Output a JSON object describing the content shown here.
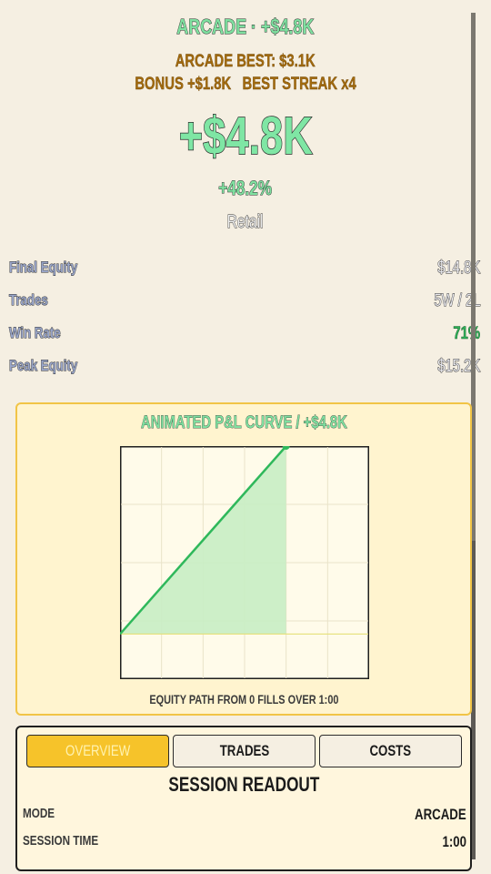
{
  "header": {
    "title": "ARCADE · +$4.8K",
    "best_line": "ARCADE BEST: $3.1K",
    "bonus_line": "BONUS +$1.8K   BEST STREAK x4",
    "pnl_big": "+$4.8K",
    "pnl_pct": "+48.2%",
    "tier": "Retail"
  },
  "stats": [
    {
      "label": "Final Equity",
      "value": "$14.8K"
    },
    {
      "label": "Trades",
      "value": "5W / 2L"
    },
    {
      "label": "Win Rate",
      "value": "71%"
    },
    {
      "label": "Peak Equity",
      "value": "$15.2K"
    }
  ],
  "chart_panel": {
    "title": "ANIMATED P&L CURVE / +$4.8K",
    "footer": "EQUITY PATH FROM 0 FILLS OVER 1:00"
  },
  "chart_data": {
    "type": "area",
    "title": "ANIMATED P&L CURVE / +$4.8K",
    "xlabel": "",
    "ylabel": "",
    "x": [
      0,
      1
    ],
    "y": [
      0,
      1
    ],
    "xlim": [
      0,
      1.5
    ],
    "ylim": [
      -0.24,
      1.0
    ],
    "grid": true,
    "colors": {
      "line": "#2fb85b",
      "fill": "#c8edc4",
      "baseline": "#e6e07a",
      "grid": "#e9e3c9"
    }
  },
  "tabs": [
    {
      "id": "overview",
      "label": "OVERVIEW",
      "active": true
    },
    {
      "id": "trades",
      "label": "TRADES",
      "active": false
    },
    {
      "id": "costs",
      "label": "COSTS",
      "active": false
    }
  ],
  "readout": {
    "title": "SESSION READOUT",
    "rows": [
      {
        "key": "MODE",
        "value": "ARCADE"
      },
      {
        "key": "SESSION TIME",
        "value": "1:00"
      }
    ]
  },
  "colors": {
    "background": "#f5efe2",
    "accent_green": "#7fe0a0",
    "gold_text": "#a36b0e",
    "panel_border": "#f1c446",
    "tab_active": "#f6c32a"
  }
}
